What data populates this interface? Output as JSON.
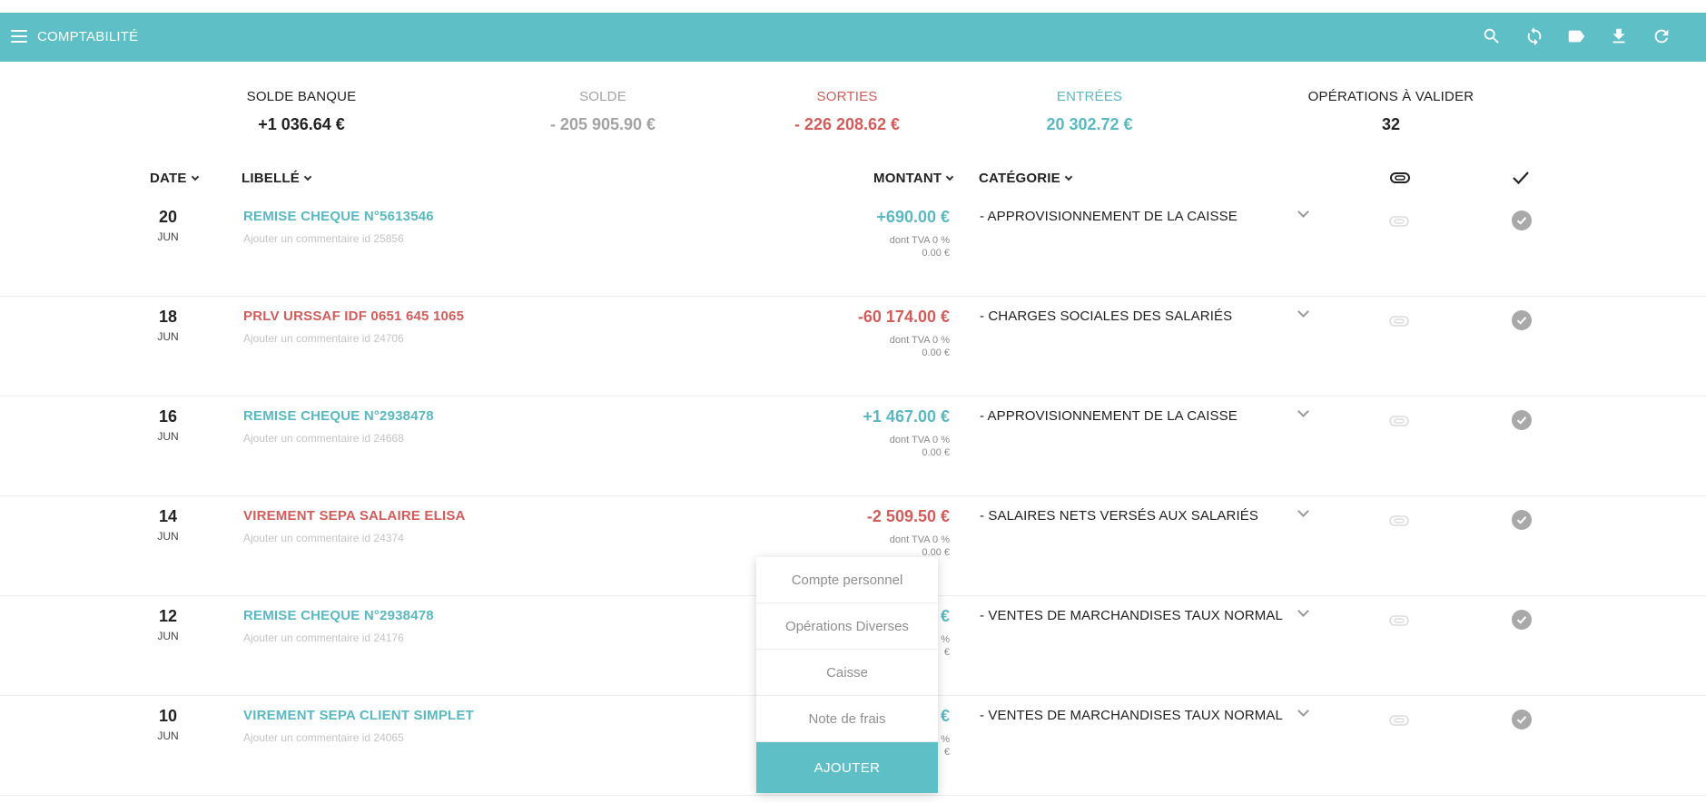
{
  "appbar": {
    "title": "COMPTABILITÉ",
    "icons": [
      "menu-icon",
      "search-icon",
      "sync-icon",
      "tag-icon",
      "download-icon",
      "refresh-icon"
    ]
  },
  "summary": {
    "bank_balance_label": "SOLDE BANQUE",
    "bank_balance_value": "+1 036.64 €",
    "balance_label": "SOLDE",
    "balance_value": "- 205 905.90 €",
    "outflows_label": "SORTIES",
    "outflows_value": "- 226 208.62 €",
    "inflows_label": "ENTRÉES",
    "inflows_value": "20 302.72 €",
    "to_validate_label": "OPÉRATIONS À VALIDER",
    "to_validate_value": "32"
  },
  "columns": {
    "date": "DATE",
    "label": "LIBELLÉ",
    "amount": "MONTANT",
    "category": "CATÉGORIE",
    "attachment_icon": "paperclip-icon",
    "validate_icon": "checkmark-icon"
  },
  "colors": {
    "accent": "#5fbfc6",
    "positive": "#5ab8c0",
    "negative": "#d25c5c",
    "neutral": "#a3a3a3"
  },
  "rows": [
    {
      "day": "20",
      "month": "JUN",
      "label": "REMISE CHEQUE N°5613546",
      "comment": "Ajouter un commentaire id 25856",
      "amount": "+690.00 €",
      "tva_label": "dont TVA 0 %",
      "tva_amount": "0.00 €",
      "category": "- APPROVISIONNEMENT DE LA CAISSE",
      "sign": "positive"
    },
    {
      "day": "18",
      "month": "JUN",
      "label": "PRLV URSSAF IDF 0651 645 1065",
      "comment": "Ajouter un commentaire id 24706",
      "amount": "-60 174.00 €",
      "tva_label": "dont TVA 0 %",
      "tva_amount": "0.00 €",
      "category": "- CHARGES SOCIALES DES SALARIÉS",
      "sign": "negative"
    },
    {
      "day": "16",
      "month": "JUN",
      "label": "REMISE CHEQUE N°2938478",
      "comment": "Ajouter un commentaire id 24668",
      "amount": "+1 467.00 €",
      "tva_label": "dont TVA 0 %",
      "tva_amount": "0.00 €",
      "category": "- APPROVISIONNEMENT DE LA CAISSE",
      "sign": "positive"
    },
    {
      "day": "14",
      "month": "JUN",
      "label": "VIREMENT SEPA SALAIRE ELISA",
      "comment": "Ajouter un commentaire id 24374",
      "amount": "-2 509.50 €",
      "tva_label": "dont TVA 0 %",
      "tva_amount": "0.00 €",
      "category": "- SALAIRES NETS VERSÉS AUX SALARIÉS",
      "sign": "negative"
    },
    {
      "day": "12",
      "month": "JUN",
      "label": "REMISE CHEQUE N°2938478",
      "comment": "Ajouter un commentaire id 24176",
      "amount": "€",
      "tva_label": "%",
      "tva_amount": "€",
      "category": "- VENTES DE MARCHANDISES TAUX NORMAL",
      "sign": "positive"
    },
    {
      "day": "10",
      "month": "JUN",
      "label": "VIREMENT SEPA CLIENT SIMPLET",
      "comment": "Ajouter un commentaire id 24065",
      "amount": "€",
      "tva_label": "%",
      "tva_amount": "€",
      "category": "- VENTES DE MARCHANDISES TAUX NORMAL",
      "sign": "positive"
    }
  ],
  "dropdown": {
    "items": [
      "Compte personnel",
      "Opérations Diverses",
      "Caisse",
      "Note de frais"
    ],
    "button": "AJOUTER"
  }
}
